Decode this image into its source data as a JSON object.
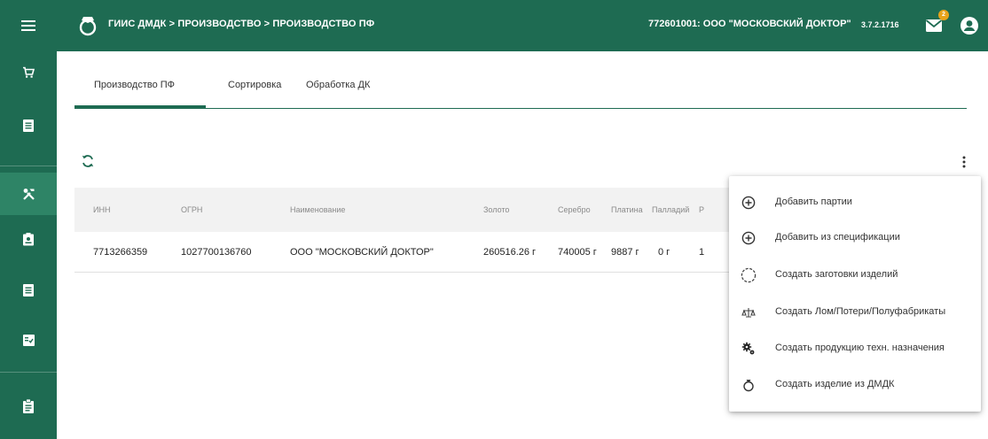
{
  "header": {
    "title": "ГИИС ДМДК > ПРОИЗВОДСТВО > ПРОИЗВОДСТВО ПФ",
    "organization": "772601001: ООО \"МОСКОВСКИЙ ДОКТОР\"",
    "version": "3.7.2.1716",
    "mail_badge": "2",
    "icons": [
      "menu-icon",
      "logo-icon",
      "mail-icon",
      "account-icon"
    ]
  },
  "sidebar": {
    "items": [
      {
        "name": "cart-icon"
      },
      {
        "name": "list-icon"
      },
      {
        "name": "tools-icon",
        "active": true
      },
      {
        "name": "badge-icon"
      },
      {
        "name": "list-icon"
      },
      {
        "name": "checklist-icon"
      },
      {
        "name": "clipboard-icon"
      }
    ]
  },
  "tabs": [
    {
      "label": "Производство ПФ",
      "active": true
    },
    {
      "label": "Сортировка"
    },
    {
      "label": "Обработка ДК"
    }
  ],
  "table": {
    "headers": [
      "ИНН",
      "ОГРН",
      "Наименование",
      "Золото",
      "Серебро",
      "Платина",
      "Палладий",
      "Р"
    ],
    "rows": [
      [
        "7713266359",
        "1027700136760",
        "ООО \"МОСКОВСКИЙ ДОКТОР\"",
        "260516.26 г",
        "740005 г",
        "9887 г",
        "0 г",
        "1"
      ]
    ]
  },
  "menu": {
    "items": [
      {
        "label": "Добавить партии",
        "icon": "add-circle-icon"
      },
      {
        "label": "Добавить из спецификации",
        "icon": "add-circle-icon"
      },
      {
        "label": "Создать заготовки изделий",
        "icon": "dashed-circle-icon"
      },
      {
        "label": "Создать Лом/Потери/Полуфабрикаты",
        "icon": "scale-icon"
      },
      {
        "label": "Создать продукцию техн. назначения",
        "icon": "gears-icon"
      },
      {
        "label": "Создать изделие из ДМДК",
        "icon": "ring-icon"
      }
    ]
  },
  "colors": {
    "primary": "#1e6b52",
    "sidebar_active": "#2e8466",
    "badge": "#e8a31a",
    "table_header_bg": "#f2f2f2"
  }
}
